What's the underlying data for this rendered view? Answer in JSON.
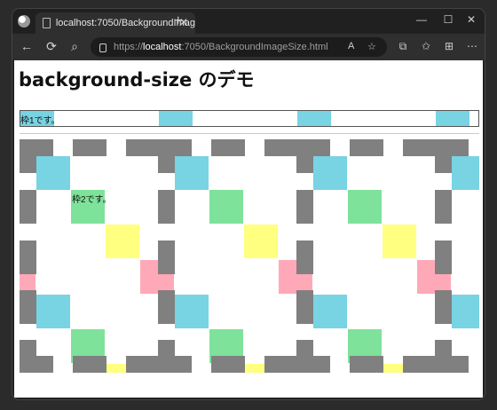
{
  "browser": {
    "tab_title": "localhost:7050/BackgroundImag",
    "tab_close": "✕",
    "new_tab": "+",
    "controls": {
      "minimize": "—",
      "maximize": "☐",
      "close": "✕"
    },
    "nav": {
      "back": "←",
      "refresh": "⟳",
      "search": "⌕"
    },
    "url": {
      "prefix": "https://",
      "host": "localhost",
      "path": ":7050/BackgroundImageSize.html"
    },
    "url_right_label": "A",
    "toolbar": {
      "favorite": "☆",
      "split": "⧉",
      "favorites": "✩",
      "collections": "⊞",
      "more": "⋯"
    }
  },
  "page": {
    "title": "background-size のデモ",
    "frame1_text": "枠1です。",
    "frame2_text": "枠2です。"
  },
  "colors": {
    "gray": "#808080",
    "cyan": "#78d3e3",
    "green": "#7ee29a",
    "yellow": "#ffff80",
    "pink": "#ffa9b8"
  }
}
